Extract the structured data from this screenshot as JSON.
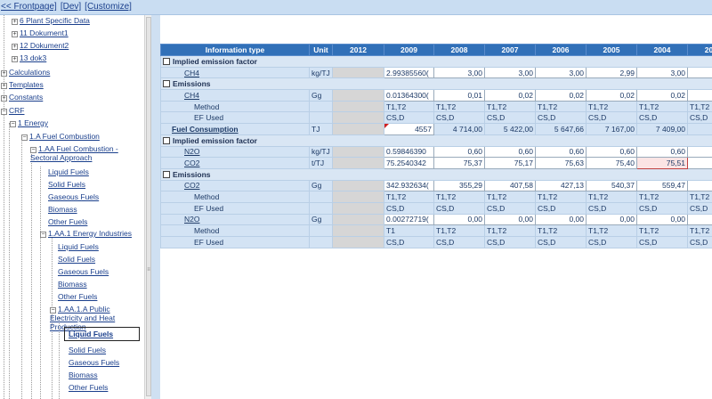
{
  "topbar": {
    "frontpage": "<< Frontpage]",
    "dev": "[Dev]",
    "customize": "[Customize]"
  },
  "tree": {
    "items": [
      {
        "label": "6 Plant Specific Data",
        "pm": "+"
      },
      {
        "label": "11 Dokument1",
        "pm": "+"
      },
      {
        "label": "12 Dokument2",
        "pm": "+"
      },
      {
        "label": "13 dok3",
        "pm": "+"
      },
      {
        "label": "Calculations",
        "pm": "+"
      },
      {
        "label": "Templates",
        "pm": "+"
      },
      {
        "label": "Constants",
        "pm": "+"
      },
      {
        "label": "CRF",
        "pm": "−"
      },
      {
        "label": "1 Energy",
        "pm": "−"
      },
      {
        "label": "1.A Fuel Combustion",
        "pm": "−"
      },
      {
        "label": "1.AA Fuel Combustion - Sectoral Approach",
        "pm": "−"
      },
      {
        "label": "Liquid Fuels"
      },
      {
        "label": "Solid Fuels"
      },
      {
        "label": "Gaseous Fuels"
      },
      {
        "label": "Biomass"
      },
      {
        "label": "Other Fuels"
      },
      {
        "label": "1.AA.1 Energy Industries",
        "pm": "−"
      },
      {
        "label": "Liquid Fuels"
      },
      {
        "label": "Solid Fuels"
      },
      {
        "label": "Gaseous Fuels"
      },
      {
        "label": "Biomass"
      },
      {
        "label": "Other Fuels"
      },
      {
        "label": "1.AA.1.A Public Electricity and Heat Production",
        "pm": "−"
      },
      {
        "label": "Liquid Fuels",
        "selected": true
      },
      {
        "label": "Solid Fuels"
      },
      {
        "label": "Gaseous Fuels"
      },
      {
        "label": "Biomass"
      },
      {
        "label": "Other Fuels"
      }
    ]
  },
  "grid": {
    "headers": [
      "Information type",
      "Unit",
      "2012",
      "2009",
      "2008",
      "2007",
      "2006",
      "2005",
      "2004",
      "20"
    ],
    "groups": {
      "ief1": "Implied emission factor",
      "em1": "Emissions",
      "ief2": "Implied emission factor",
      "em2": "Emissions"
    },
    "rows": {
      "ch4_ief": {
        "name": "CH4",
        "unit": "kg/TJ",
        "v2012": "",
        "v2009": "2.99385560(",
        "v2008": "3,00",
        "v2007": "3,00",
        "v2006": "3,00",
        "v2005": "2,99",
        "v2004": "3,00",
        "v20": ""
      },
      "ch4_em": {
        "name": "CH4",
        "unit": "Gg",
        "v2012": "",
        "v2009": "0.01364300(",
        "v2008": "0,01",
        "v2007": "0,02",
        "v2006": "0,02",
        "v2005": "0,02",
        "v2004": "0,02",
        "v20": ""
      },
      "ch4_method": {
        "name": "Method",
        "unit": "",
        "v2012": "",
        "v2009": "T1,T2",
        "v2008": "T1,T2",
        "v2007": "T1,T2",
        "v2006": "T1,T2",
        "v2005": "T1,T2",
        "v2004": "T1,T2",
        "v20": "T1,T2"
      },
      "ch4_ef": {
        "name": "EF Used",
        "unit": "",
        "v2012": "",
        "v2009": "CS,D",
        "v2008": "CS,D",
        "v2007": "CS,D",
        "v2006": "CS,D",
        "v2005": "CS,D",
        "v2004": "CS,D",
        "v20": "CS,D"
      },
      "fuel": {
        "name": "Fuel Consumption",
        "unit": "TJ",
        "v2012": "",
        "v2009": "4557",
        "v2008": "4 714,00",
        "v2007": "5 422,00",
        "v2006": "5 647,66",
        "v2005": "7 167,00",
        "v2004": "7 409,00",
        "v20": "8 1"
      },
      "n2o_ief": {
        "name": "N2O",
        "unit": "kg/TJ",
        "v2012": "",
        "v2009": "0.59846390",
        "v2008": "0,60",
        "v2007": "0,60",
        "v2006": "0,60",
        "v2005": "0,60",
        "v2004": "0,60",
        "v20": ""
      },
      "co2_ief": {
        "name": "CO2",
        "unit": "t/TJ",
        "v2012": "",
        "v2009": "75.2540342",
        "v2008": "75,37",
        "v2007": "75,17",
        "v2006": "75,63",
        "v2005": "75,40",
        "v2004": "75,51",
        "v20": ""
      },
      "co2_em": {
        "name": "CO2",
        "unit": "Gg",
        "v2012": "",
        "v2009": "342.932634(",
        "v2008": "355,29",
        "v2007": "407,58",
        "v2006": "427,13",
        "v2005": "540,37",
        "v2004": "559,47",
        "v20": "6"
      },
      "co2_method": {
        "name": "Method",
        "unit": "",
        "v2012": "",
        "v2009": "T1,T2",
        "v2008": "T1,T2",
        "v2007": "T1,T2",
        "v2006": "T1,T2",
        "v2005": "T1,T2",
        "v2004": "T1,T2",
        "v20": "T1,T2"
      },
      "co2_ef": {
        "name": "EF Used",
        "unit": "",
        "v2012": "",
        "v2009": "CS,D",
        "v2008": "CS,D",
        "v2007": "CS,D",
        "v2006": "CS,D",
        "v2005": "CS,D",
        "v2004": "CS,D",
        "v20": "CS,D"
      },
      "n2o_em": {
        "name": "N2O",
        "unit": "Gg",
        "v2012": "",
        "v2009": "0.00272719(",
        "v2008": "0,00",
        "v2007": "0,00",
        "v2006": "0,00",
        "v2005": "0,00",
        "v2004": "0,00",
        "v20": ""
      },
      "n2o_method": {
        "name": "Method",
        "unit": "",
        "v2012": "",
        "v2009": "T1",
        "v2008": "T1,T2",
        "v2007": "T1,T2",
        "v2006": "T1,T2",
        "v2005": "T1,T2",
        "v2004": "T1,T2",
        "v20": "T1,T2"
      },
      "n2o_ef": {
        "name": "EF Used",
        "unit": "",
        "v2012": "",
        "v2009": "CS,D",
        "v2008": "CS,D",
        "v2007": "CS,D",
        "v2006": "CS,D",
        "v2005": "CS,D",
        "v2004": "CS,D",
        "v20": "CS,D"
      }
    }
  }
}
